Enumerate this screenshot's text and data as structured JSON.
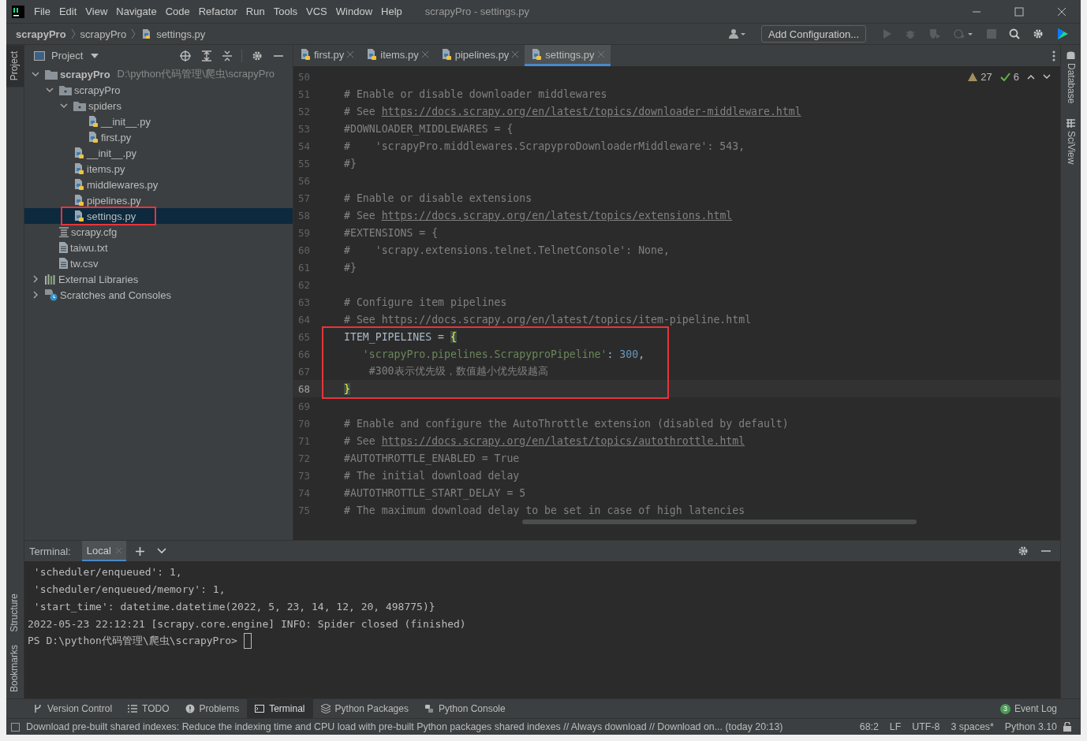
{
  "window": {
    "title": "scrapyPro - settings.py"
  },
  "menu": [
    "File",
    "Edit",
    "View",
    "Navigate",
    "Code",
    "Refactor",
    "Run",
    "Tools",
    "VCS",
    "Window",
    "Help"
  ],
  "breadcrumbs": [
    "scrapyPro",
    "scrapyPro",
    "settings.py"
  ],
  "toolbar": {
    "run_config": "Add Configuration..."
  },
  "left_tools": [
    {
      "label": "Project",
      "selected": true
    },
    {
      "label": "Structure",
      "selected": false
    },
    {
      "label": "Bookmarks",
      "selected": false
    }
  ],
  "right_tools": [
    "Database",
    "SciView"
  ],
  "project": {
    "title": "Project",
    "tree": [
      {
        "label": "scrapyPro",
        "kind": "project",
        "path": "D:\\python代码管理\\爬虫\\scrapyPro",
        "expanded": true,
        "selected": false,
        "boxed": false,
        "children": [
          {
            "label": "scrapyPro",
            "kind": "package",
            "expanded": true,
            "selected": false,
            "boxed": false,
            "children": [
              {
                "label": "spiders",
                "kind": "package",
                "expanded": true,
                "selected": false,
                "boxed": false,
                "children": [
                  {
                    "label": "__init__.py",
                    "kind": "python",
                    "selected": false,
                    "boxed": false
                  },
                  {
                    "label": "first.py",
                    "kind": "python",
                    "selected": false,
                    "boxed": false
                  }
                ]
              },
              {
                "label": "__init__.py",
                "kind": "python",
                "selected": false,
                "boxed": false
              },
              {
                "label": "items.py",
                "kind": "python",
                "selected": false,
                "boxed": false
              },
              {
                "label": "middlewares.py",
                "kind": "python",
                "selected": false,
                "boxed": false
              },
              {
                "label": "pipelines.py",
                "kind": "python",
                "selected": false,
                "boxed": false
              },
              {
                "label": "settings.py",
                "kind": "python",
                "selected": true,
                "boxed": true
              }
            ]
          },
          {
            "label": "scrapy.cfg",
            "kind": "config",
            "selected": false,
            "boxed": false
          },
          {
            "label": "taiwu.txt",
            "kind": "text",
            "selected": false,
            "boxed": false
          },
          {
            "label": "tw.csv",
            "kind": "text",
            "selected": false,
            "boxed": false
          }
        ]
      },
      {
        "label": "External Libraries",
        "kind": "libraries",
        "expanded": false,
        "selected": false,
        "boxed": false
      },
      {
        "label": "Scratches and Consoles",
        "kind": "scratches",
        "expanded": false,
        "selected": false,
        "boxed": false
      }
    ]
  },
  "tabs": [
    {
      "label": "first.py",
      "selected": false
    },
    {
      "label": "items.py",
      "selected": false
    },
    {
      "label": "pipelines.py",
      "selected": false
    },
    {
      "label": "settings.py",
      "selected": true
    }
  ],
  "editor": {
    "warnings": "27",
    "checks": "6",
    "lines": [
      {
        "num": "50"
      },
      {
        "num": "51",
        "segs": [
          {
            "text": "# Enable or disable downloader middlewares",
            "kind": "comment"
          }
        ]
      },
      {
        "num": "52",
        "segs": [
          {
            "text": "# See ",
            "kind": "comment"
          },
          {
            "text": "https://docs.scrapy.org/en/latest/topics/downloader-middleware.html",
            "kind": "link"
          }
        ]
      },
      {
        "num": "53",
        "segs": [
          {
            "text": "#DOWNLOADER_MIDDLEWARES = {",
            "kind": "comment"
          }
        ]
      },
      {
        "num": "54",
        "segs": [
          {
            "text": "#    'scrapyPro.middlewares.ScrapyproDownloaderMiddleware': 543,",
            "kind": "comment"
          }
        ]
      },
      {
        "num": "55",
        "segs": [
          {
            "text": "#}",
            "kind": "comment"
          }
        ]
      },
      {
        "num": "56"
      },
      {
        "num": "57",
        "segs": [
          {
            "text": "# Enable or disable extensions",
            "kind": "comment"
          }
        ]
      },
      {
        "num": "58",
        "segs": [
          {
            "text": "# See ",
            "kind": "comment"
          },
          {
            "text": "https://docs.scrapy.org/en/latest/topics/extensions.html",
            "kind": "link"
          }
        ]
      },
      {
        "num": "59",
        "segs": [
          {
            "text": "#EXTENSIONS = {",
            "kind": "comment"
          }
        ]
      },
      {
        "num": "60",
        "segs": [
          {
            "text": "#    'scrapy.extensions.telnet.TelnetConsole': None,",
            "kind": "comment"
          }
        ]
      },
      {
        "num": "61",
        "segs": [
          {
            "text": "#}",
            "kind": "comment"
          }
        ]
      },
      {
        "num": "62"
      },
      {
        "num": "63",
        "segs": [
          {
            "text": "# Configure item pipelines",
            "kind": "comment"
          }
        ]
      },
      {
        "num": "64",
        "segs": [
          {
            "text": "# See https://docs.scrapy.org/en/latest/topics/item-pipeline.html",
            "kind": "comment"
          }
        ]
      },
      {
        "num": "65",
        "boxed": true,
        "segs": [
          {
            "text": "ITEM_PIPELINES = ",
            "kind": "plain"
          },
          {
            "text": "{",
            "kind": "brace"
          }
        ]
      },
      {
        "num": "66",
        "boxed": true,
        "indented": true,
        "segs": [
          {
            "text": "'scrapyPro.pipelines.ScrapyproPipeline'",
            "kind": "string"
          },
          {
            "text": ": ",
            "kind": "plain"
          },
          {
            "text": "300",
            "kind": "number"
          },
          {
            "text": ",",
            "kind": "plain"
          }
        ]
      },
      {
        "num": "67",
        "boxed": true,
        "indented": true,
        "segs": [
          {
            "text": " #300表示优先级，数值越小优先级越高",
            "kind": "comment"
          }
        ]
      },
      {
        "num": "68",
        "boxed": true,
        "current": true,
        "segs": [
          {
            "text": "}",
            "kind": "brace"
          }
        ]
      },
      {
        "num": "69"
      },
      {
        "num": "70",
        "segs": [
          {
            "text": "# Enable and configure the AutoThrottle extension (disabled by default)",
            "kind": "comment"
          }
        ]
      },
      {
        "num": "71",
        "segs": [
          {
            "text": "# See ",
            "kind": "comment"
          },
          {
            "text": "https://docs.scrapy.org/en/latest/topics/autothrottle.html",
            "kind": "link"
          }
        ]
      },
      {
        "num": "72",
        "segs": [
          {
            "text": "#AUTOTHROTTLE_ENABLED = True",
            "kind": "comment"
          }
        ]
      },
      {
        "num": "73",
        "segs": [
          {
            "text": "# The initial download delay",
            "kind": "comment"
          }
        ]
      },
      {
        "num": "74",
        "segs": [
          {
            "text": "#AUTOTHROTTLE_START_DELAY = 5",
            "kind": "comment"
          }
        ]
      },
      {
        "num": "75",
        "segs": [
          {
            "text": "# The maximum download delay to be set in case of high latencies",
            "kind": "comment"
          }
        ]
      }
    ]
  },
  "terminal": {
    "title": "Terminal:",
    "tab": "Local",
    "lines": [
      {
        "text": " 'scheduler/enqueued': 1,",
        "kind": "output"
      },
      {
        "text": " 'scheduler/enqueued/memory': 1,",
        "kind": "output"
      },
      {
        "text": " 'start_time': datetime.datetime(2022, 5, 23, 14, 12, 20, 498775)}",
        "kind": "output"
      },
      {
        "text": "2022-05-23 22:12:21 [scrapy.core.engine] INFO: Spider closed (finished)",
        "kind": "output"
      },
      {
        "text": "PS D:\\python代码管理\\爬虫\\scrapyPro> ",
        "kind": "prompt"
      }
    ]
  },
  "tool_tabs": [
    {
      "label": "Version Control",
      "kind": "vcs",
      "selected": false
    },
    {
      "label": "TODO",
      "kind": "todo",
      "selected": false
    },
    {
      "label": "Problems",
      "kind": "problems",
      "selected": false
    },
    {
      "label": "Terminal",
      "kind": "terminal",
      "selected": true
    },
    {
      "label": "Python Packages",
      "kind": "packages",
      "selected": false
    },
    {
      "label": "Python Console",
      "kind": "console",
      "selected": false
    }
  ],
  "event_log": {
    "label": "Event Log",
    "count": "3"
  },
  "status_bar": {
    "message": "Download pre-built shared indexes: Reduce the indexing time and CPU load with pre-built Python packages shared indexes // Always download // Download on... (today 20:13)",
    "items": [
      "68:2",
      "LF",
      "UTF-8",
      "3 spaces*",
      "Python 3.10"
    ]
  }
}
